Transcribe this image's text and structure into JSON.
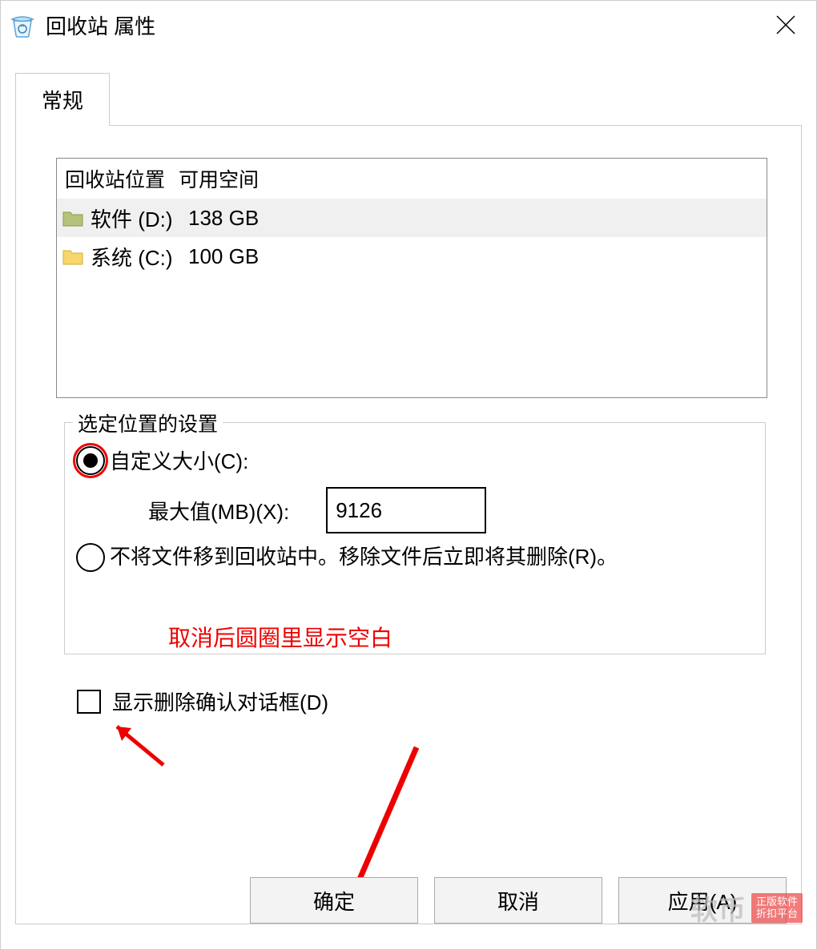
{
  "window": {
    "title": "回收站 属性"
  },
  "tabs": [
    {
      "label": "常规"
    }
  ],
  "location_table": {
    "col_location": "回收站位置",
    "col_space": "可用空间",
    "rows": [
      {
        "name": "软件 (D:)",
        "space": "138 GB",
        "selected": true,
        "folder_color": "#b4c27a"
      },
      {
        "name": "系统 (C:)",
        "space": "100 GB",
        "selected": false,
        "folder_color": "#f7d66b"
      }
    ]
  },
  "group": {
    "title": "选定位置的设置",
    "custom_size_label": "自定义大小(C):",
    "max_label": "最大值(MB)(X):",
    "max_value": "9126",
    "dont_move_label": "不将文件移到回收站中。移除文件后立即将其删除(R)。"
  },
  "checkbox": {
    "label": "显示删除确认对话框(D)",
    "checked": false
  },
  "annotation": {
    "text": "取消后圆圈里显示空白",
    "color": "#e00"
  },
  "buttons": {
    "ok": "确定",
    "cancel": "取消",
    "apply": "应用(A)"
  },
  "watermark": {
    "text": "软币",
    "badge_line1": "正版软件",
    "badge_line2": "折扣平台"
  },
  "icons": {
    "recycle_bin": "recycle-bin-icon",
    "close": "close-icon",
    "folder": "folder-icon"
  }
}
